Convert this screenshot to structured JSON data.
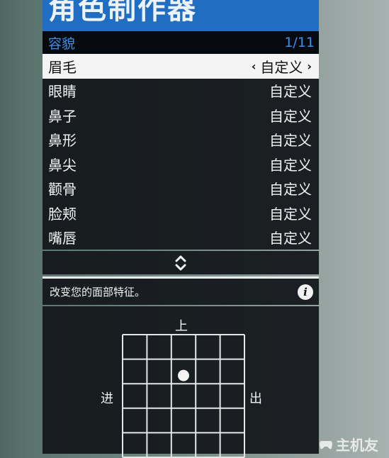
{
  "header": {
    "title": "角色制作器"
  },
  "subheader": {
    "category": "容貌",
    "page_indicator": "1/11"
  },
  "menu_items": [
    {
      "label": "眉毛",
      "value": "自定义",
      "selected": true
    },
    {
      "label": "眼睛",
      "value": "自定义"
    },
    {
      "label": "鼻子",
      "value": "自定义"
    },
    {
      "label": "鼻形",
      "value": "自定义"
    },
    {
      "label": "鼻尖",
      "value": "自定义"
    },
    {
      "label": "颧骨",
      "value": "自定义"
    },
    {
      "label": "脸颊",
      "value": "自定义"
    },
    {
      "label": "嘴唇",
      "value": "自定义"
    }
  ],
  "selector": {
    "left_arrow": "‹",
    "right_arrow": "›"
  },
  "scroll": {
    "icon": "up-down-chevron-icon"
  },
  "description": {
    "text": "改变您的面部特征。",
    "icon": "info-icon",
    "icon_glyph": "i"
  },
  "grid": {
    "top_label": "上",
    "left_label": "进",
    "right_label": "出",
    "handle_x": 0.5,
    "handle_y": 0.333
  },
  "watermark": {
    "text": "主机友"
  },
  "colors": {
    "title_bar": "#1f6ec4",
    "subheader_text": "#3d8ee6",
    "selected_row": "#f4f4f4"
  }
}
